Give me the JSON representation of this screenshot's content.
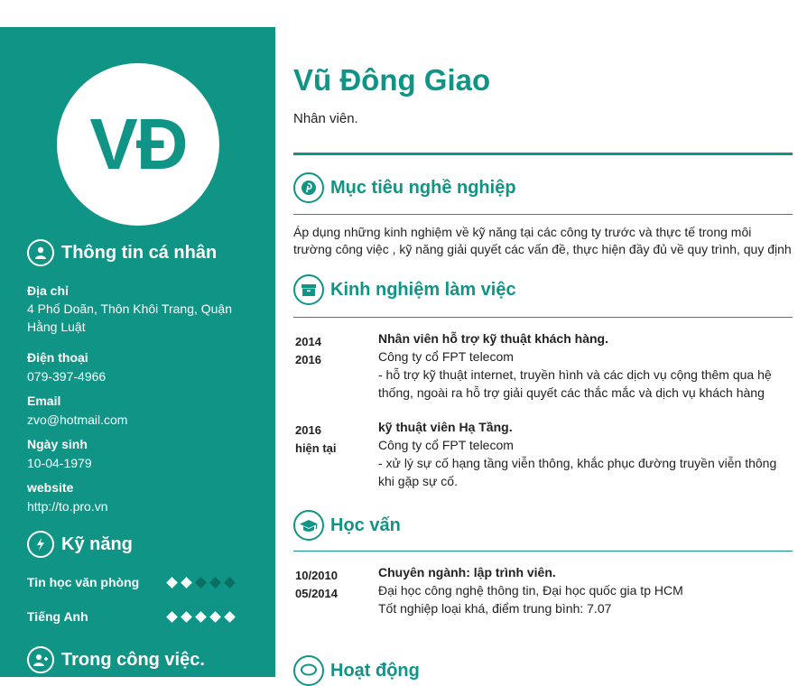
{
  "profile": {
    "initials": "VĐ",
    "name": "Vũ Đông Giao",
    "role": "Nhân viên."
  },
  "personal": {
    "title": "Thông tin cá nhân",
    "address_label": "Địa chỉ",
    "address_line1": "4 Phố Doãn, Thôn Khôi Trang, Quận",
    "address_line2": "Hằng Luật",
    "phone_label": "Điện thoại",
    "phone": "079-397-4966",
    "email_label": "Email",
    "email": "zvo@hotmail.com",
    "birthday_label": "Ngày sinh",
    "birthday": "10-04-1979",
    "website_label": "website",
    "website": "http://to.pro.vn"
  },
  "skills": {
    "title": "Kỹ năng",
    "items": [
      {
        "name": "Tin học văn phòng",
        "level": 2,
        "max": 5
      },
      {
        "name": "Tiếng Anh",
        "level": 5,
        "max": 5
      }
    ]
  },
  "work_style": {
    "title": "Trong công việc."
  },
  "objective": {
    "title": "Mục tiêu nghề nghiệp",
    "line1": "Áp dụng những kinh nghiệm về kỹ năng tại các công ty trước và thực tế trong môi",
    "line2": "trường công việc , kỹ năng giải quyết các vấn đề, thực hiện đầy đủ về quy trình, quy định"
  },
  "experience": {
    "title": "Kinh nghiệm làm việc",
    "items": [
      {
        "from": "2014",
        "to": "2016",
        "position": "Nhân viên hỗ trợ kỹ thuật khách hàng.",
        "company": "Công ty cổ FPT telecom",
        "desc1": "- hỗ trợ kỹ thuật internet, truyền hình và các dịch vụ cộng thêm qua hệ",
        "desc2": "thống, ngoài ra hỗ trợ giải quyết các thắc mắc và dịch vụ khách hàng"
      },
      {
        "from": "2016",
        "to": "hiện tại",
        "position": "kỹ thuật viên Hạ Tầng.",
        "company": "Công ty cổ FPT telecom",
        "desc1": "- xử lý sự cố hạng tầng viễn thông, khắc phục đường truyền viễn thông",
        "desc2": "khi gặp sự cố."
      }
    ]
  },
  "education": {
    "title": "Học vấn",
    "items": [
      {
        "from": "10/2010",
        "to": "05/2014",
        "major": "Chuyên ngành: lập trình viên.",
        "school": "Đại học công nghệ thông tin, Đại học quốc gia tp HCM",
        "result": "Tốt nghiệp loại khá, điểm trung bình: 7.07"
      }
    ]
  },
  "activities": {
    "title": "Hoạt động"
  },
  "colors": {
    "accent": "#0f9486",
    "accent_dark": "#0b6e63",
    "text": "#222222"
  }
}
